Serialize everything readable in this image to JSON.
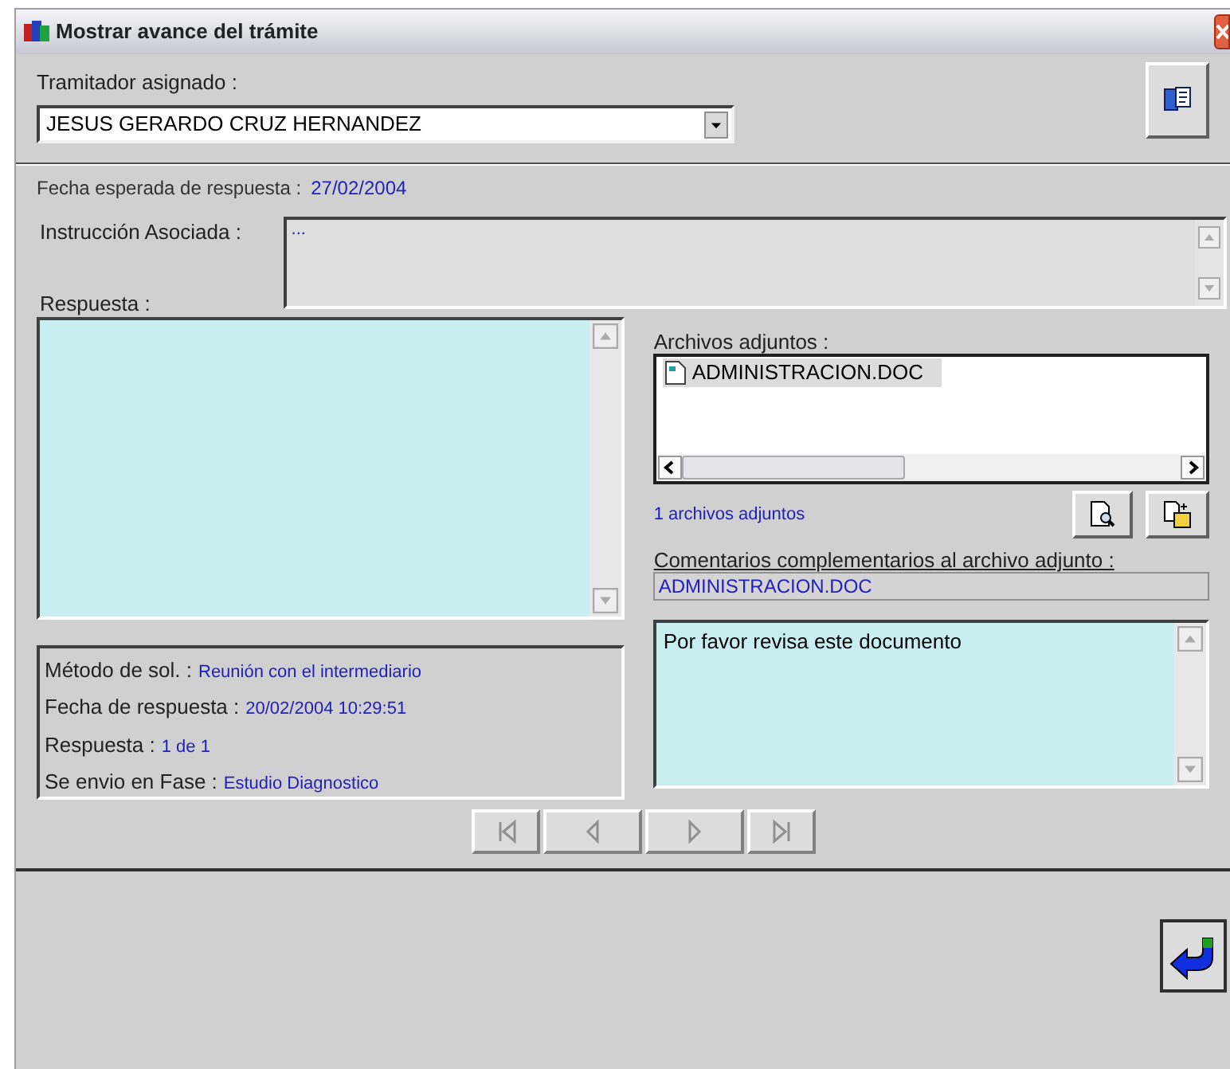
{
  "window": {
    "title": "Mostrar avance del trámite"
  },
  "assignee": {
    "label": "Tramitador asignado :",
    "value": "JESUS GERARDO CRUZ HERNANDEZ"
  },
  "expected_date": {
    "label": "Fecha esperada de respuesta :",
    "value": "27/02/2004"
  },
  "instruction": {
    "label": "Instrucción Asociada :",
    "value": "..."
  },
  "response": {
    "label": "Respuesta :"
  },
  "attachments": {
    "label": "Archivos adjuntos :",
    "count": "1 archivos adjuntos",
    "files": [
      {
        "name": "ADMINISTRACION.DOC",
        "selected": true
      }
    ]
  },
  "info": [
    {
      "label": "Método de sol. :",
      "value": "Reunión con el intermediario"
    },
    {
      "label": "Fecha de respuesta :",
      "value": "20/02/2004 10:29:51"
    },
    {
      "label": "Respuesta :",
      "value": "1 de 1"
    },
    {
      "label": "Se envio en Fase :",
      "value": "Estudio Diagnostico"
    }
  ],
  "comments": {
    "label": "Comentarios complementarios al archivo adjunto :",
    "file": "ADMINISTRACION.DOC",
    "text": "Por favor revisa este documento"
  },
  "nav": [
    {
      "kind": "first",
      "disabled": true
    },
    {
      "kind": "prev",
      "disabled": true
    },
    {
      "kind": "next",
      "disabled": true
    },
    {
      "kind": "last",
      "disabled": true
    }
  ]
}
